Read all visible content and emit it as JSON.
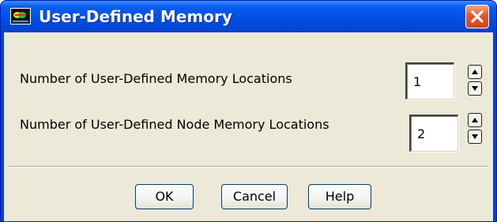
{
  "window": {
    "title": "User-Defined Memory",
    "title_icon": "fluent-app-icon",
    "close_icon": "close-icon"
  },
  "fields": [
    {
      "label": "Number of User-Defined Memory Locations",
      "value": "1"
    },
    {
      "label": "Number of User-Defined Node Memory Locations",
      "value": "2"
    }
  ],
  "buttons": {
    "ok": "OK",
    "cancel": "Cancel",
    "help": "Help"
  },
  "colors": {
    "titlebar": "#0251e6",
    "client_background": "#ece9d8",
    "close_button": "#e2582c"
  }
}
